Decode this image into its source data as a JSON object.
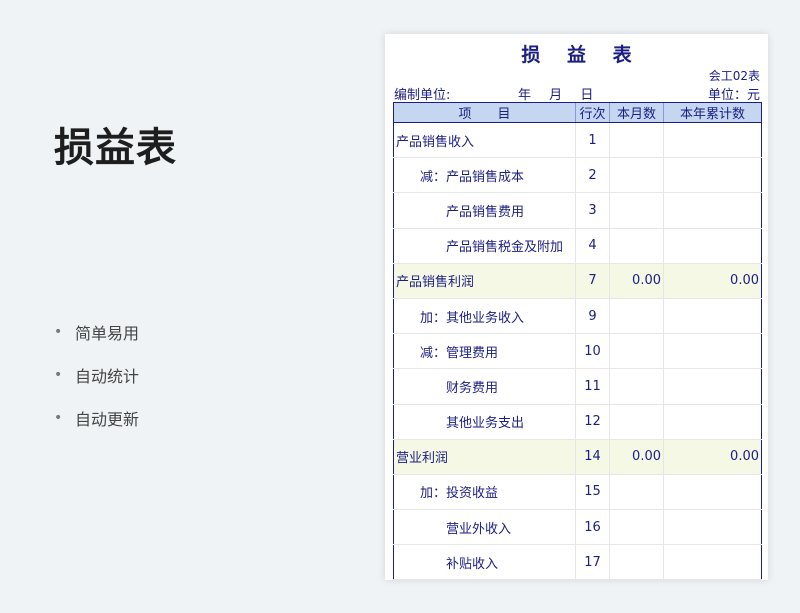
{
  "slide": {
    "title": "损益表",
    "features": [
      "简单易用",
      "自动统计",
      "自动更新"
    ],
    "bullet": "•"
  },
  "sheet": {
    "title_chars": [
      "损",
      "益",
      "表"
    ],
    "form_code": "会工02表",
    "org_label": "编制单位:",
    "date_parts": [
      "年",
      "月",
      "日"
    ],
    "unit_label": "单位：元",
    "headers": {
      "item": "项　　目",
      "line_no": "行次",
      "this_month": "本月数",
      "ytd": "本年累计数"
    },
    "rows": [
      {
        "item": "产品销售收入",
        "no": "1",
        "month": "",
        "ytd": "",
        "indent": 0,
        "total": false
      },
      {
        "item": "减：产品销售成本",
        "no": "2",
        "month": "",
        "ytd": "",
        "indent": 1,
        "total": false
      },
      {
        "item": "产品销售费用",
        "no": "3",
        "month": "",
        "ytd": "",
        "indent": 2,
        "total": false
      },
      {
        "item": "产品销售税金及附加",
        "no": "4",
        "month": "",
        "ytd": "",
        "indent": 2,
        "total": false
      },
      {
        "item": "产品销售利润",
        "no": "7",
        "month": "0.00",
        "ytd": "0.00",
        "indent": 0,
        "total": true
      },
      {
        "item": "加：其他业务收入",
        "no": "9",
        "month": "",
        "ytd": "",
        "indent": 1,
        "total": false
      },
      {
        "item": "减：管理费用",
        "no": "10",
        "month": "",
        "ytd": "",
        "indent": 1,
        "total": false
      },
      {
        "item": "财务费用",
        "no": "11",
        "month": "",
        "ytd": "",
        "indent": 2,
        "total": false
      },
      {
        "item": "其他业务支出",
        "no": "12",
        "month": "",
        "ytd": "",
        "indent": 2,
        "total": false
      },
      {
        "item": "营业利润",
        "no": "14",
        "month": "0.00",
        "ytd": "0.00",
        "indent": 0,
        "total": true
      },
      {
        "item": "加：投资收益",
        "no": "15",
        "month": "",
        "ytd": "",
        "indent": 1,
        "total": false
      },
      {
        "item": "营业外收入",
        "no": "16",
        "month": "",
        "ytd": "",
        "indent": 2,
        "total": false
      },
      {
        "item": "补贴收入",
        "no": "17",
        "month": "",
        "ytd": "",
        "indent": 2,
        "total": false
      }
    ]
  },
  "colors": {
    "ink": "#1b1e82",
    "header_fill": "#c5d6f0",
    "total_fill": "#f6f8e6",
    "background": "#f0f3f6"
  }
}
